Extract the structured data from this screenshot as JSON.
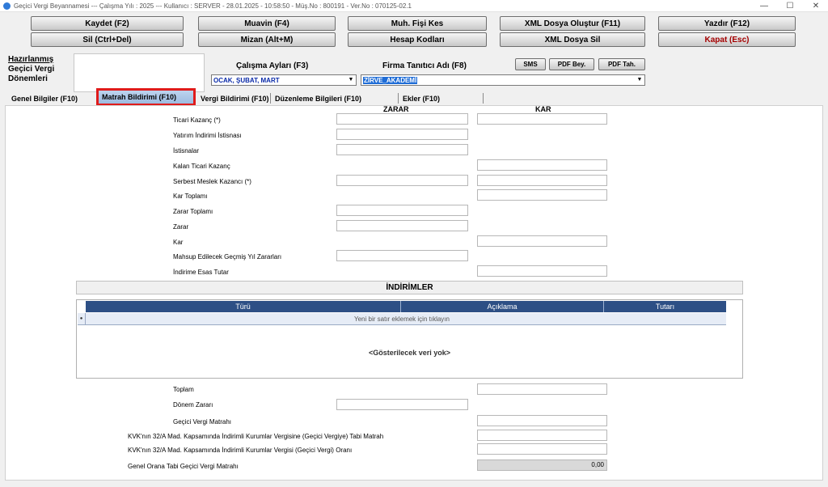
{
  "window": {
    "title": "Geçici Vergi Beyannamesi  ---  Çalışma Yılı : 2025  ---  Kullanıcı : SERVER - 28.01.2025 - 10:58:50 - Müş.No : 800191 - Ver.No : 070125-02.1",
    "minimize": "—",
    "maximize": "☐",
    "close": "✕"
  },
  "toolbar": {
    "kaydet": "Kaydet (F2)",
    "muavin": "Muavin (F4)",
    "muh_fisi_kes": "Muh. Fişi Kes",
    "xml_olustur": "XML Dosya Oluştur (F11)",
    "yazdir": "Yazdır (F12)",
    "sil": "Sil (Ctrl+Del)",
    "mizan": "Mizan (Alt+M)",
    "hesap_kodlari": "Hesap Kodları",
    "xml_sil": "XML Dosya Sil",
    "kapat": "Kapat (Esc)"
  },
  "header": {
    "hazirlanmis_line1": "Hazırlanmış",
    "hazirlanmis_line2": "Geçici Vergi",
    "hazirlanmis_line3": "Dönemleri",
    "calisma_aylari_label": "Çalışma Ayları (F3)",
    "calisma_aylari_value": "OCAK, ŞUBAT, MART",
    "firma_label": "Firma Tanıtıcı Adı (F8)",
    "firma_value": "ZİRVE_AKADEMİ",
    "sms": "SMS",
    "pdf_bey": "PDF Bey.",
    "pdf_tah": "PDF Tah."
  },
  "tabs": {
    "genel": "Genel Bilgiler (F10)",
    "matrah": "Matrah Bildirimi (F10)",
    "vergi": "Vergi Bildirimi (F10)",
    "duzenleme": "Düzenleme Bilgileri  (F10)",
    "ekler": "Ekler (F10)"
  },
  "matrah": {
    "col_zarar": "ZARAR",
    "col_kar": "KAR",
    "ticari_kazanc": "Ticari Kazanç (*)",
    "yatirim_indirimi": "Yatırım İndirimi İstisnası",
    "istisnalar": "İstisnalar",
    "kalan_ticari": "Kalan Ticari Kazanç",
    "serbest_meslek": "Serbest Meslek Kazancı (*)",
    "kar_toplami": "Kar Toplamı",
    "zarar_toplami": "Zarar Toplamı",
    "zarar": "Zarar",
    "kar": "Kar",
    "mahsup": "Mahsup Edilecek Geçmiş Yıl Zararları",
    "indirime_esas": "İndirime Esas Tutar"
  },
  "indirimler": {
    "title": "İNDİRİMLER",
    "col_turu": "Türü",
    "col_aciklama": "Açıklama",
    "col_tutari": "Tutarı",
    "new_row": "Yeni bir satır eklemek için tıklayın",
    "empty": "<Gösterilecek veri yok>"
  },
  "alt": {
    "toplam": "Toplam",
    "donem_zarari": "Dönem Zararı",
    "gecici_matrah": "Geçici Vergi Matrahı",
    "kvk_matrah": "KVK'nın 32/A Mad. Kapsamında İndirimli Kurumlar Vergisine (Geçici Vergiye) Tabi Matrah",
    "kvk_orani": "KVK'nın 32/A Mad. Kapsamında İndirimli Kurumlar Vergisi (Geçici Vergi) Oranı",
    "genel_orana": "Genel Orana Tabi Geçici Vergi Matrahı",
    "genel_orana_value": "0,00"
  }
}
